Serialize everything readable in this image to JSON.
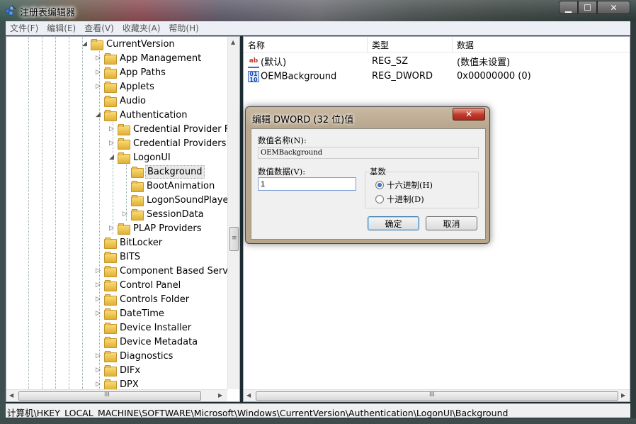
{
  "window": {
    "title": "注册表编辑器",
    "minimize_label": "▁",
    "maximize_label": "☐",
    "close_label": "✕"
  },
  "menu": [
    "文件(F)",
    "编辑(E)",
    "查看(V)",
    "收藏夹(A)",
    "帮助(H)"
  ],
  "tree": {
    "items": [
      {
        "label": "CurrentVersion",
        "expander": "◢"
      },
      {
        "label": "App Management",
        "expander": "▷"
      },
      {
        "label": "App Paths",
        "expander": "▷"
      },
      {
        "label": "Applets",
        "expander": "▷"
      },
      {
        "label": "Audio",
        "expander": ""
      },
      {
        "label": "Authentication",
        "expander": "◢"
      },
      {
        "label": "Credential Provider Filte",
        "expander": "▷"
      },
      {
        "label": "Credential Providers",
        "expander": "▷"
      },
      {
        "label": "LogonUI",
        "expander": "◢"
      },
      {
        "label": "Background",
        "expander": ""
      },
      {
        "label": "BootAnimation",
        "expander": ""
      },
      {
        "label": "LogonSoundPlayed",
        "expander": ""
      },
      {
        "label": "SessionData",
        "expander": "▷"
      },
      {
        "label": "PLAP Providers",
        "expander": "▷"
      },
      {
        "label": "BitLocker",
        "expander": ""
      },
      {
        "label": "BITS",
        "expander": ""
      },
      {
        "label": "Component Based Servicir",
        "expander": "▷"
      },
      {
        "label": "Control Panel",
        "expander": "▷"
      },
      {
        "label": "Controls Folder",
        "expander": "▷"
      },
      {
        "label": "DateTime",
        "expander": "▷"
      },
      {
        "label": "Device Installer",
        "expander": ""
      },
      {
        "label": "Device Metadata",
        "expander": ""
      },
      {
        "label": "Diagnostics",
        "expander": "▷"
      },
      {
        "label": "DIFx",
        "expander": "▷"
      },
      {
        "label": "DPX",
        "expander": "▷"
      }
    ],
    "scroll_grip": "≡",
    "hscroll_grip": "III"
  },
  "list": {
    "columns": [
      "名称",
      "类型",
      "数据"
    ],
    "rows": [
      {
        "name": "(默认)",
        "type": "REG_SZ",
        "data": "(数值未设置)",
        "icon": "string-value-icon"
      },
      {
        "name": "OEMBackground",
        "type": "REG_DWORD",
        "data": "0x00000000 (0)",
        "icon": "binary-value-icon"
      }
    ],
    "hscroll_grip": "III"
  },
  "status": {
    "path": "计算机\\HKEY_LOCAL_MACHINE\\SOFTWARE\\Microsoft\\Windows\\CurrentVersion\\Authentication\\LogonUI\\Background"
  },
  "dialog": {
    "title": "编辑 DWORD (32 位)值",
    "close_label": "✕",
    "name_label": "数值名称(N):",
    "name_value": "OEMBackground",
    "data_label": "数值数据(V):",
    "data_value": "1",
    "base_label": "基数",
    "radio_hex": "十六进制(H)",
    "radio_dec": "十进制(D)",
    "ok_label": "确定",
    "cancel_label": "取消"
  },
  "colors": {
    "selection_accent": "#3c7fb1",
    "dialog_close": "#c0392b"
  }
}
